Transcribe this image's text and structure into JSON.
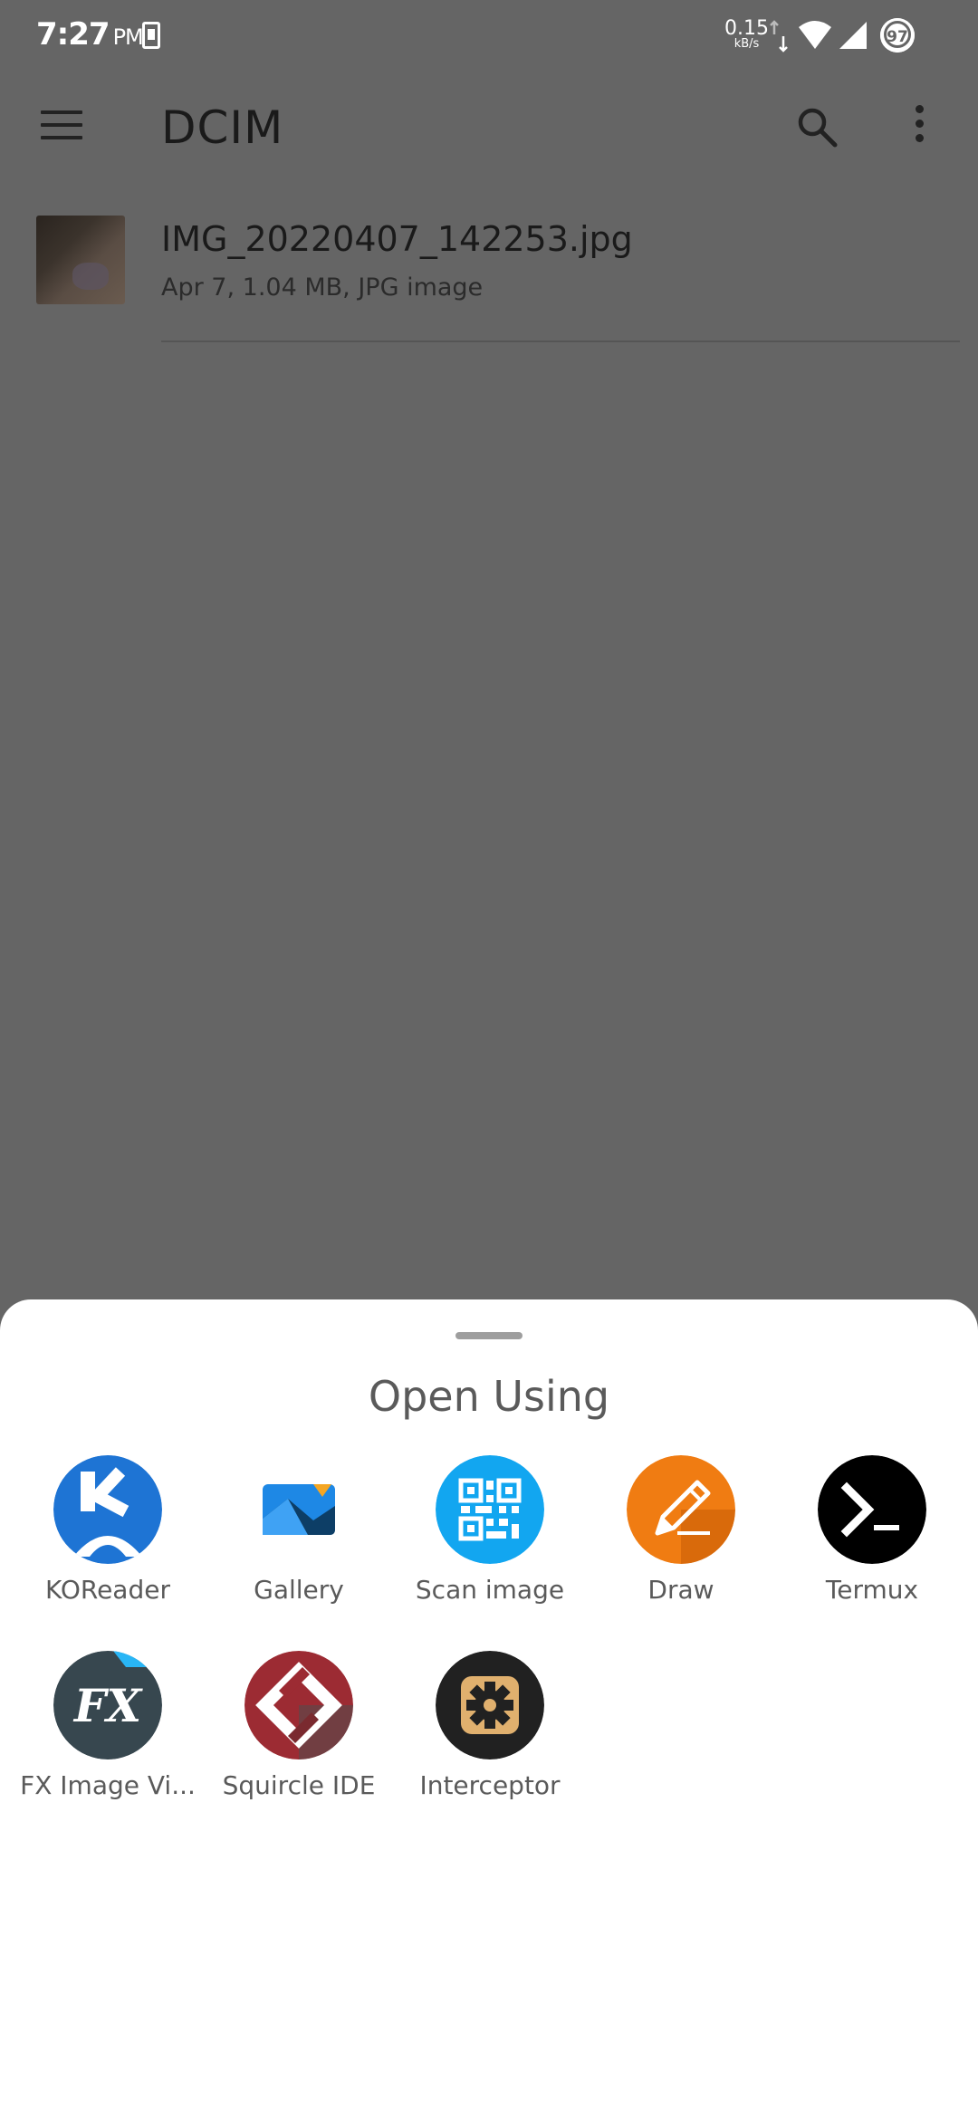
{
  "status_bar": {
    "time": "7:27",
    "ampm": "PM",
    "net_speed": "0.15",
    "net_unit": "kB/s",
    "battery": "97"
  },
  "app_bar": {
    "title": "DCIM"
  },
  "files": [
    {
      "name": "IMG_20220407_142253.jpg",
      "meta": "Apr 7, 1.04 MB, JPG image"
    }
  ],
  "sheet": {
    "title": "Open Using",
    "apps": [
      {
        "label": "KOReader",
        "icon": "koreader-icon"
      },
      {
        "label": "Gallery",
        "icon": "gallery-icon"
      },
      {
        "label": "Scan image",
        "icon": "qr-scan-icon"
      },
      {
        "label": "Draw",
        "icon": "pencil-icon"
      },
      {
        "label": "Termux",
        "icon": "terminal-icon"
      },
      {
        "label": "FX Image Vi...",
        "icon": "fx-icon"
      },
      {
        "label": "Squircle IDE",
        "icon": "squircle-ide-icon"
      },
      {
        "label": "Interceptor",
        "icon": "gear-icon"
      }
    ]
  },
  "colors": {
    "scrim": "#656565",
    "sheet_bg": "#ffffff",
    "koreader": "#1e74d4",
    "scan": "#12a6f0",
    "draw": "#f07c12",
    "termux": "#000000",
    "fx": "#37474f",
    "squircle": "#9c2b33",
    "interceptor": "#212121"
  }
}
